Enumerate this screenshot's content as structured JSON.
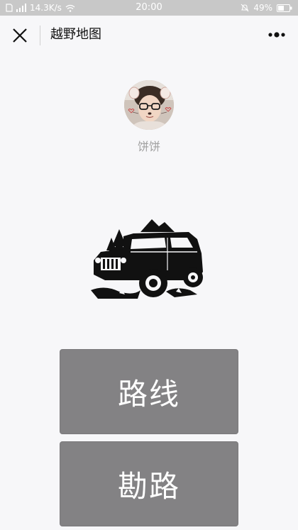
{
  "status_bar": {
    "signal_text": "4G",
    "speed": "14.3K/s",
    "time": "20:00",
    "battery": "49%",
    "icons": [
      "sim-icon",
      "signal-icon",
      "wifi-icon",
      "alarm-off-icon",
      "battery-icon"
    ]
  },
  "header": {
    "title": "越野地图",
    "close_icon": "close-icon",
    "more_icon": "more-icon"
  },
  "profile": {
    "name": "饼饼"
  },
  "actions": {
    "route_label": "路线",
    "survey_label": "勘路"
  },
  "colors": {
    "background": "#f7f7f9",
    "status_bar": "#c8c8c8",
    "button": "#838284",
    "button_text": "#ffffff"
  }
}
